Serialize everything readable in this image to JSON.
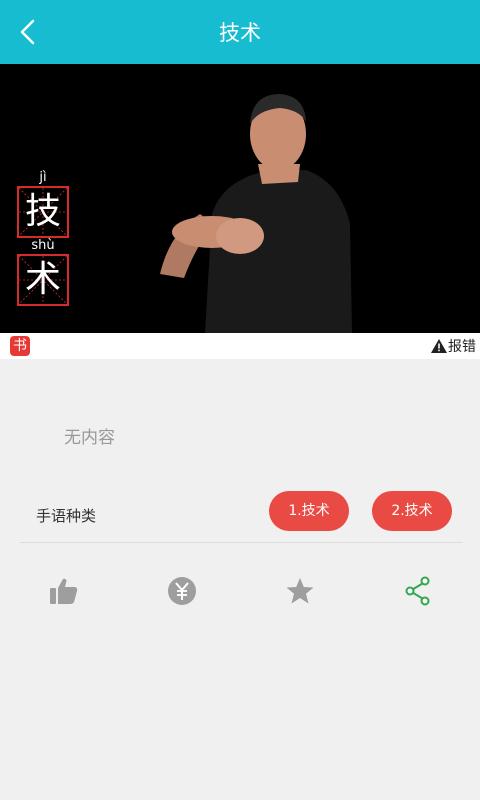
{
  "header": {
    "title": "技术",
    "back_icon": "chevron-left-icon",
    "background_color": "#17bcd0"
  },
  "video": {
    "characters": [
      {
        "pinyin": "jì",
        "hanzi": "技"
      },
      {
        "pinyin": "shù",
        "hanzi": "术"
      }
    ]
  },
  "info_strip": {
    "badge_text": "书",
    "report_label": "报错"
  },
  "content": {
    "empty_text": "无内容"
  },
  "sign_types": {
    "label": "手语种类",
    "options": [
      "1.技术",
      "2.技术"
    ],
    "accent_color": "#e94a43"
  },
  "actions": [
    {
      "name": "like",
      "icon": "thumbs-up-icon",
      "color": "#9e9e9e"
    },
    {
      "name": "tip",
      "icon": "yuan-coin-icon",
      "color": "#9e9e9e"
    },
    {
      "name": "favorite",
      "icon": "star-icon",
      "color": "#9e9e9e"
    },
    {
      "name": "share",
      "icon": "share-icon",
      "color": "#2fa84f"
    }
  ]
}
